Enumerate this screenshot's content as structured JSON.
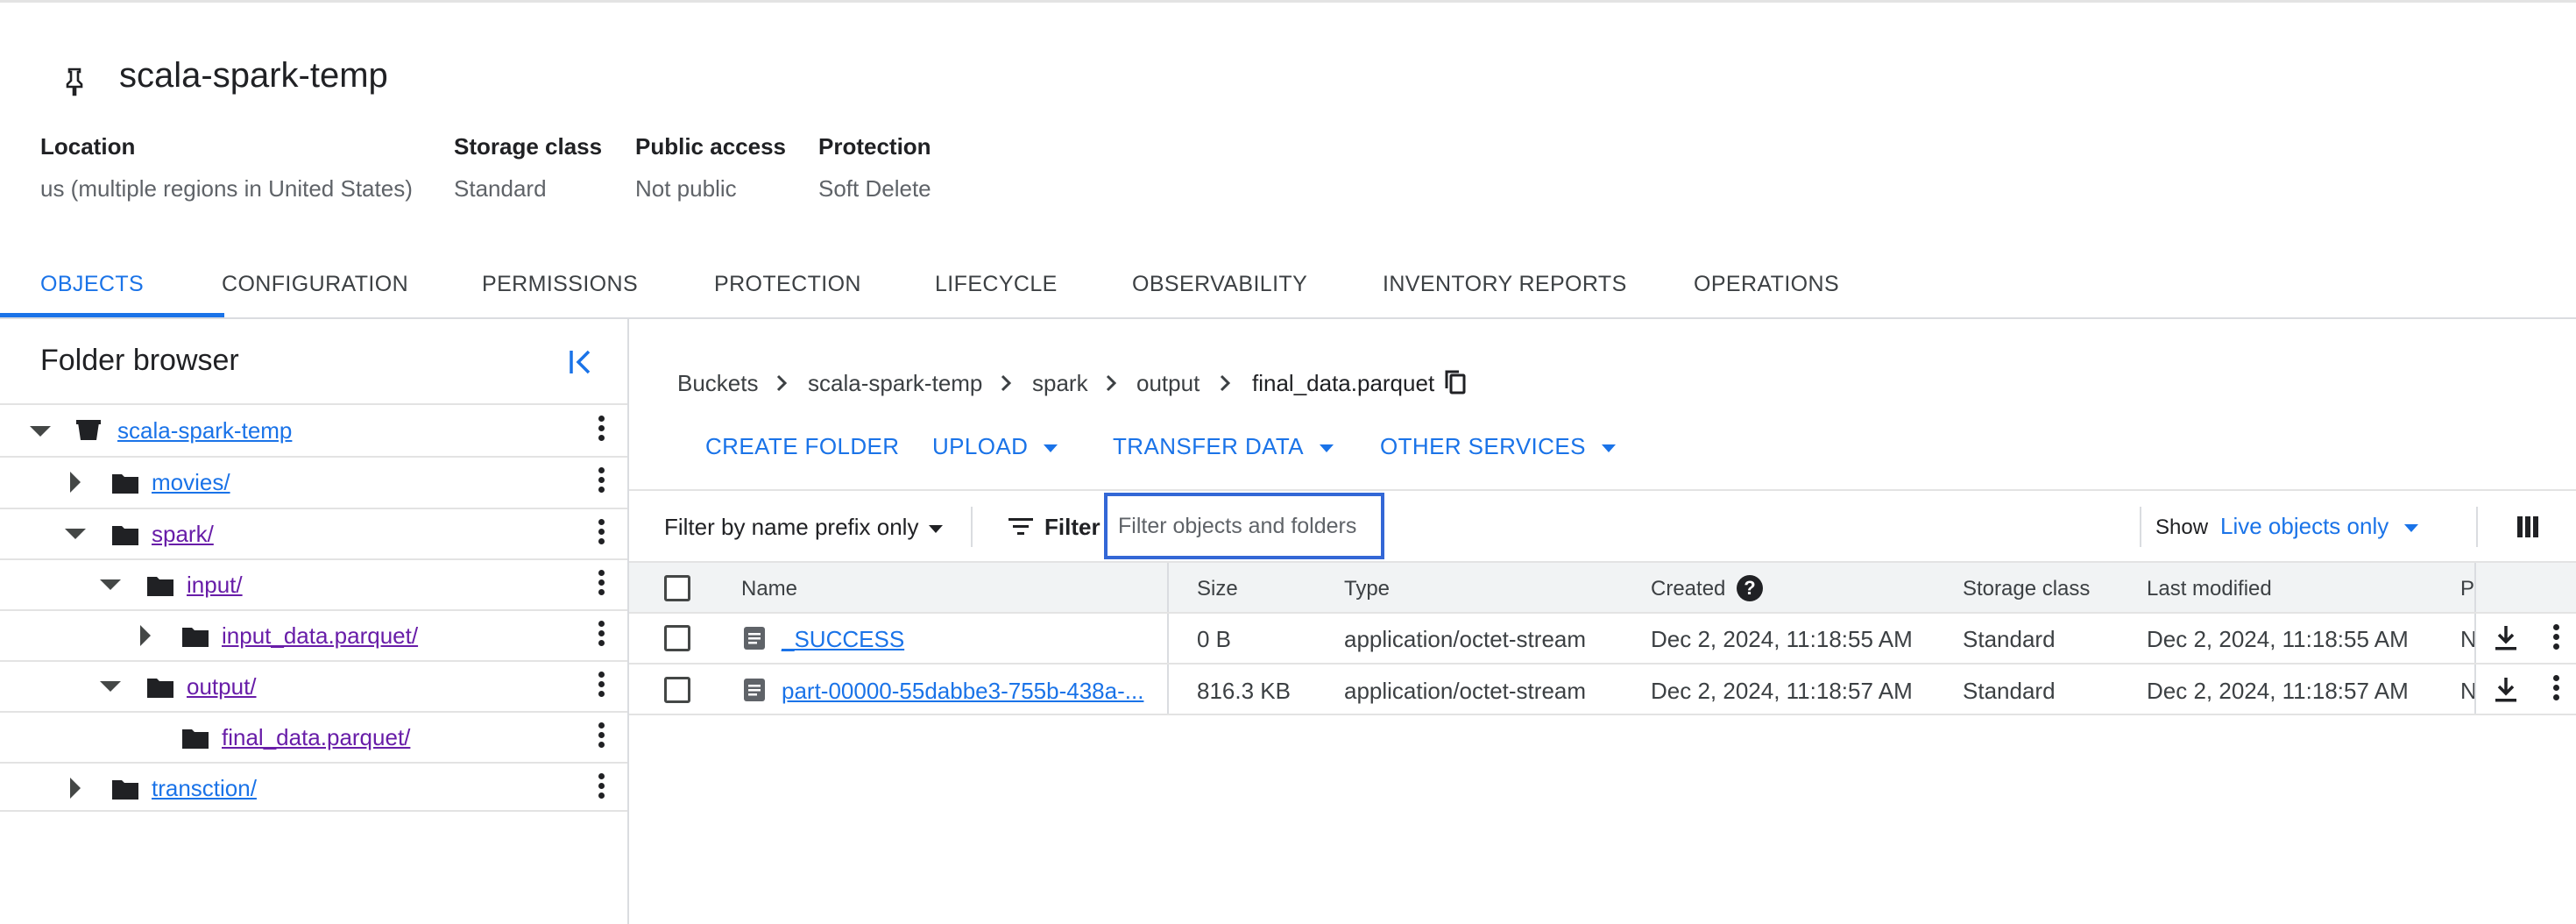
{
  "header": {
    "title": "scala-spark-temp",
    "meta": [
      {
        "label": "Location",
        "value": "us (multiple regions in United States)"
      },
      {
        "label": "Storage class",
        "value": "Standard"
      },
      {
        "label": "Public access",
        "value": "Not public"
      },
      {
        "label": "Protection",
        "value": "Soft Delete"
      }
    ]
  },
  "tabs": [
    "OBJECTS",
    "CONFIGURATION",
    "PERMISSIONS",
    "PROTECTION",
    "LIFECYCLE",
    "OBSERVABILITY",
    "INVENTORY REPORTS",
    "OPERATIONS"
  ],
  "active_tab": "OBJECTS",
  "folder_browser": {
    "title": "Folder browser",
    "items": [
      {
        "label": "scala-spark-temp",
        "expanded": true,
        "type": "bucket"
      },
      {
        "label": "movies/",
        "expanded": false,
        "type": "folder"
      },
      {
        "label": "spark/",
        "expanded": true,
        "type": "folder"
      },
      {
        "label": "input/",
        "expanded": true,
        "type": "folder"
      },
      {
        "label": "input_data.parquet/",
        "expanded": false,
        "type": "folder"
      },
      {
        "label": "output/",
        "expanded": true,
        "type": "folder"
      },
      {
        "label": "final_data.parquet/",
        "expanded": false,
        "type": "folder"
      },
      {
        "label": "transction/",
        "expanded": false,
        "type": "folder"
      }
    ]
  },
  "breadcrumb": [
    "Buckets",
    "scala-spark-temp",
    "spark",
    "output",
    "final_data.parquet"
  ],
  "actions": [
    "CREATE FOLDER",
    "UPLOAD",
    "TRANSFER DATA",
    "OTHER SERVICES"
  ],
  "filter": {
    "mode": "Filter by name prefix only",
    "button": "Filter",
    "placeholder": "Filter objects and folders",
    "value": "",
    "show_label": "Show",
    "show_value": "Live objects only"
  },
  "table": {
    "columns": [
      "Name",
      "Size",
      "Type",
      "Created",
      "Storage class",
      "Last modified",
      "P"
    ],
    "rows": [
      {
        "name": "_SUCCESS",
        "size": "0 B",
        "type": "application/octet-stream",
        "created": "Dec 2, 2024, 11:18:55 AM",
        "storage_class": "Standard",
        "last_modified": "Dec 2, 2024, 11:18:55 AM",
        "p": "N"
      },
      {
        "name": "part-00000-55dabbe3-755b-438a-...",
        "size": "816.3 KB",
        "type": "application/octet-stream",
        "created": "Dec 2, 2024, 11:18:57 AM",
        "storage_class": "Standard",
        "last_modified": "Dec 2, 2024, 11:18:57 AM",
        "p": "N"
      }
    ]
  },
  "icons": [
    "pin-icon",
    "collapse-panel-icon",
    "bucket-icon",
    "folder-icon",
    "copy-icon",
    "filter-lines-icon",
    "columns-icon",
    "help-icon",
    "file-icon",
    "download-icon",
    "more-vert-icon"
  ],
  "colors": {
    "accent": "#1a73e8",
    "visited_link": "#681da8",
    "focus_border": "#3367d6"
  }
}
